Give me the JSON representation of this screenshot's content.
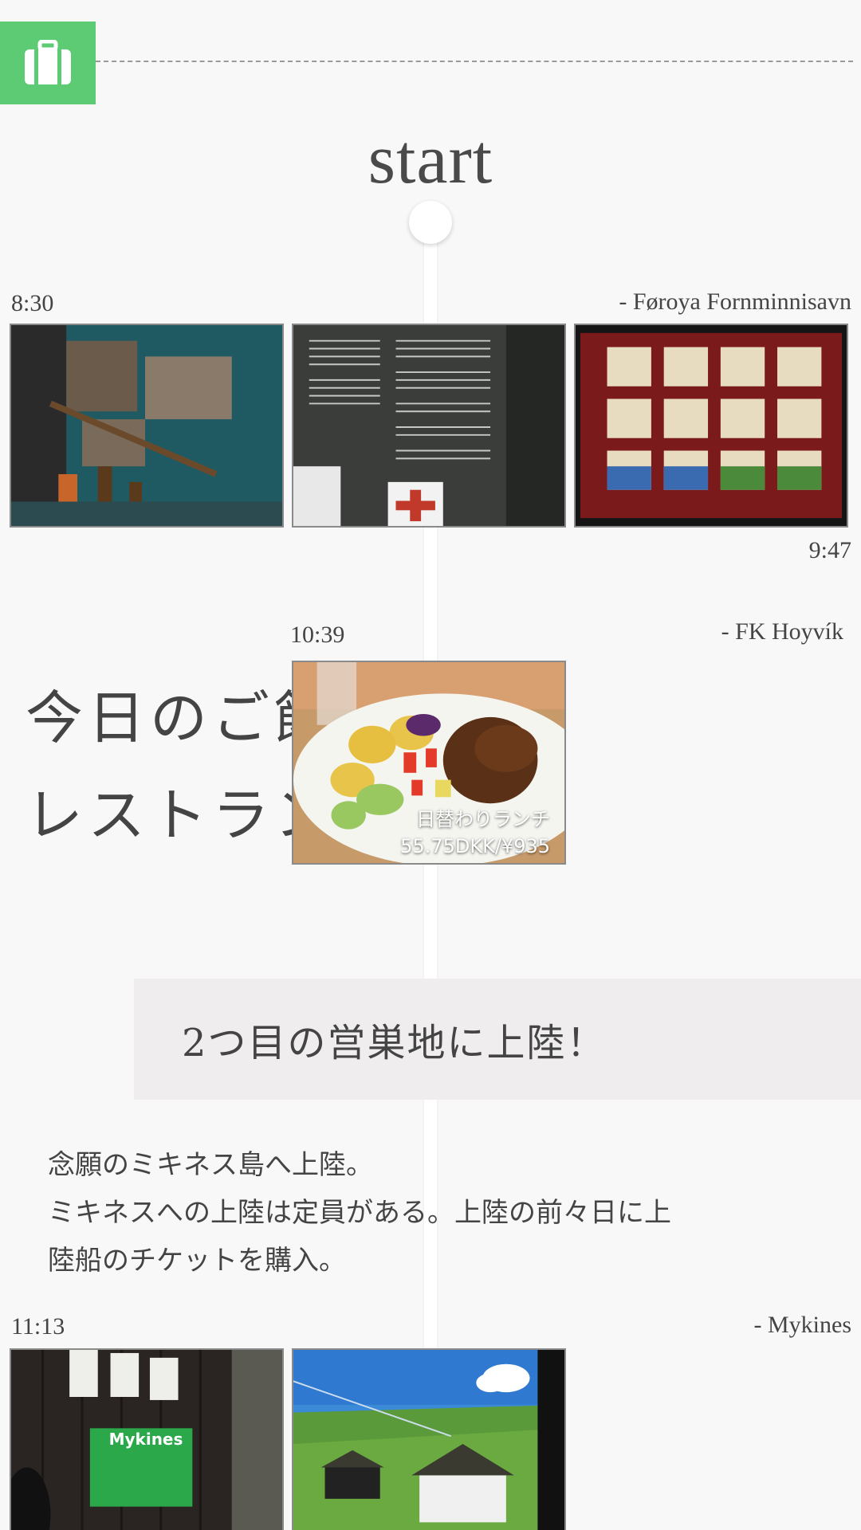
{
  "header": {
    "bag_icon": "suitcase-icon",
    "accent": "#5ccb73",
    "start_label": "start"
  },
  "entries": [
    {
      "time": "8:30",
      "place": "- Føroya Fornminnisavn",
      "end_time": "9:47",
      "photos": [
        {
          "subject": "museum display of wooden artifacts and photos"
        },
        {
          "subject": "exhibition text panel"
        },
        {
          "subject": "embroidered tapestry panels"
        }
      ]
    },
    {
      "time": "10:39",
      "place": "- FK Hoyvík",
      "heading_line1": "今日のご飯",
      "heading_line2": "レストラン",
      "photo_caption_line1": "日替わりランチ",
      "photo_caption_line2": "55.75DKK/¥935"
    }
  ],
  "section": {
    "title": "2つ目の営巣地に上陸！",
    "body_line1": "念願のミキネス島へ上陸。",
    "body_line2": "ミキネスへの上陸は定員がある。上陸の前々日に上",
    "body_line3": "陸船のチケットを購入。"
  },
  "mykines": {
    "time": "11:13",
    "place": "- Mykines",
    "sign_text": "Mykines"
  }
}
